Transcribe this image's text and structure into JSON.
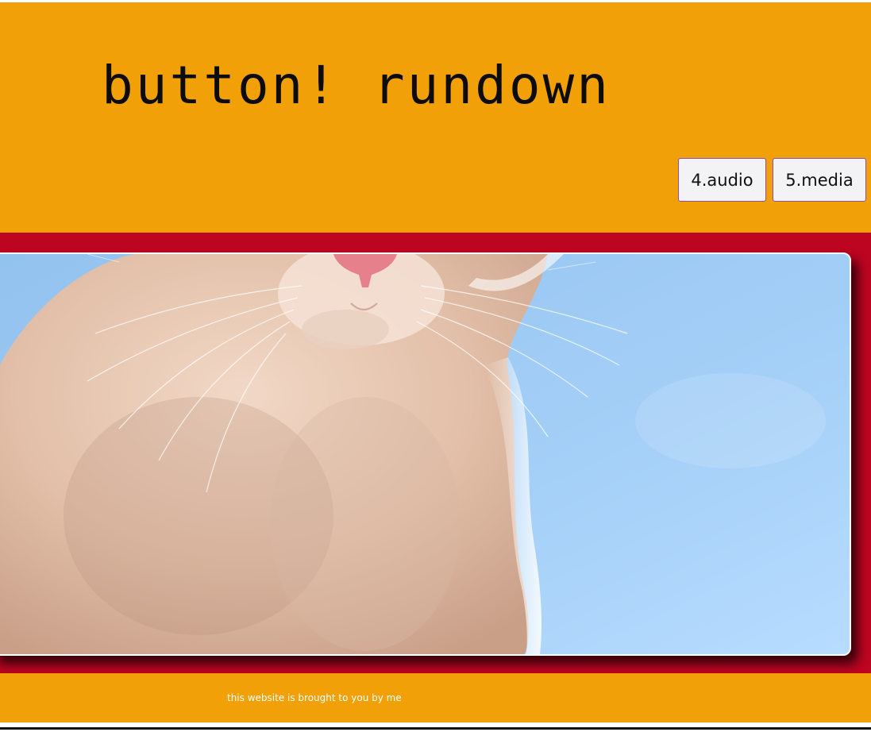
{
  "header": {
    "title": "button! rundown",
    "nav": [
      {
        "label": "4.audio"
      },
      {
        "label": "5.media"
      }
    ]
  },
  "main": {
    "image_subject": "kitten-photo"
  },
  "footer": {
    "text": "this website is brought to you by me"
  },
  "colors": {
    "header_background": "#f2a007",
    "main_background": "#bd0521",
    "footer_background": "#f2a007",
    "button_border": "#8a4fb5",
    "title_text": "#0c0c0c",
    "footer_text": "#ffffff"
  }
}
